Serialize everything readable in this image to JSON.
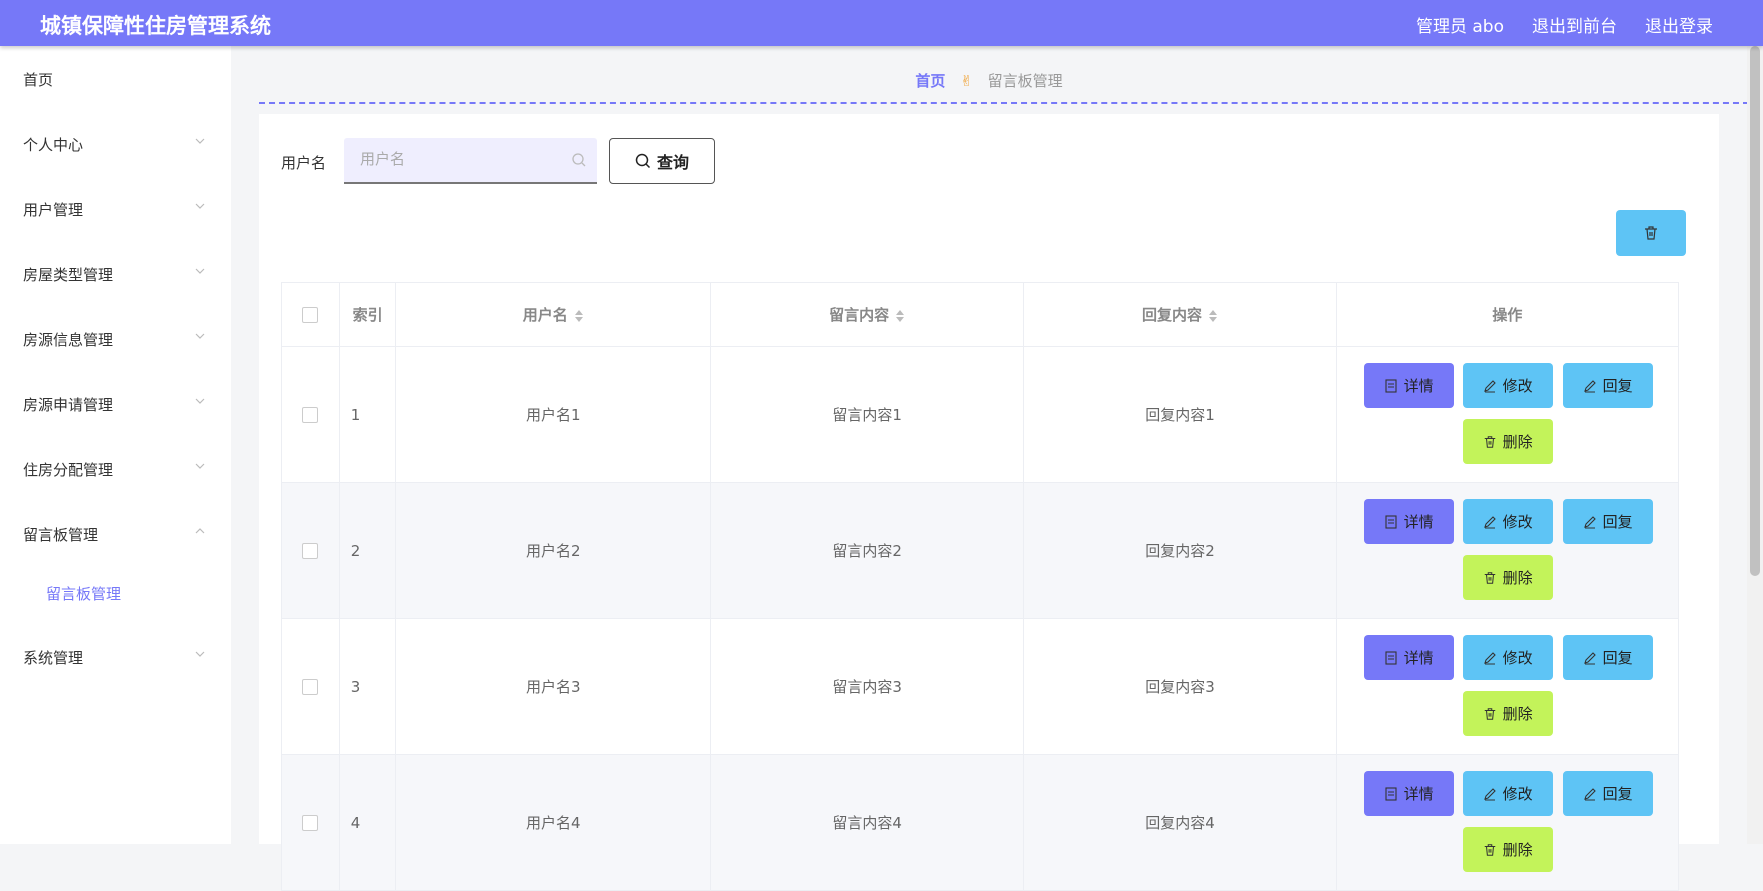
{
  "app": {
    "title": "城镇保障性住房管理系统"
  },
  "header": {
    "admin": "管理员 abo",
    "to_front": "退出到前台",
    "logout": "退出登录"
  },
  "sidebar": {
    "items": [
      {
        "label": "首页",
        "has_chevron": false
      },
      {
        "label": "个人中心",
        "has_chevron": true
      },
      {
        "label": "用户管理",
        "has_chevron": true
      },
      {
        "label": "房屋类型管理",
        "has_chevron": true
      },
      {
        "label": "房源信息管理",
        "has_chevron": true
      },
      {
        "label": "房源申请管理",
        "has_chevron": true
      },
      {
        "label": "住房分配管理",
        "has_chevron": true
      },
      {
        "label": "留言板管理",
        "has_chevron": true,
        "expanded": true
      },
      {
        "label": "留言板管理",
        "sub": true
      },
      {
        "label": "系统管理",
        "has_chevron": true
      }
    ]
  },
  "breadcrumb": {
    "home": "首页",
    "current": "留言板管理"
  },
  "search": {
    "label": "用户名",
    "placeholder": "用户名",
    "button": "查询"
  },
  "table": {
    "headers": {
      "index": "索引",
      "username": "用户名",
      "content": "留言内容",
      "reply": "回复内容",
      "ops": "操作"
    },
    "rows": [
      {
        "index": "1",
        "username": "用户名1",
        "content": "留言内容1",
        "reply": "回复内容1"
      },
      {
        "index": "2",
        "username": "用户名2",
        "content": "留言内容2",
        "reply": "回复内容2"
      },
      {
        "index": "3",
        "username": "用户名3",
        "content": "留言内容3",
        "reply": "回复内容3"
      },
      {
        "index": "4",
        "username": "用户名4",
        "content": "留言内容4",
        "reply": "回复内容4"
      }
    ],
    "actions": {
      "detail": "详情",
      "edit": "修改",
      "reply": "回复",
      "delete": "删除"
    }
  },
  "colors": {
    "primary": "#7678f8",
    "info": "#5ec4f5",
    "danger": "#c3f35a"
  }
}
